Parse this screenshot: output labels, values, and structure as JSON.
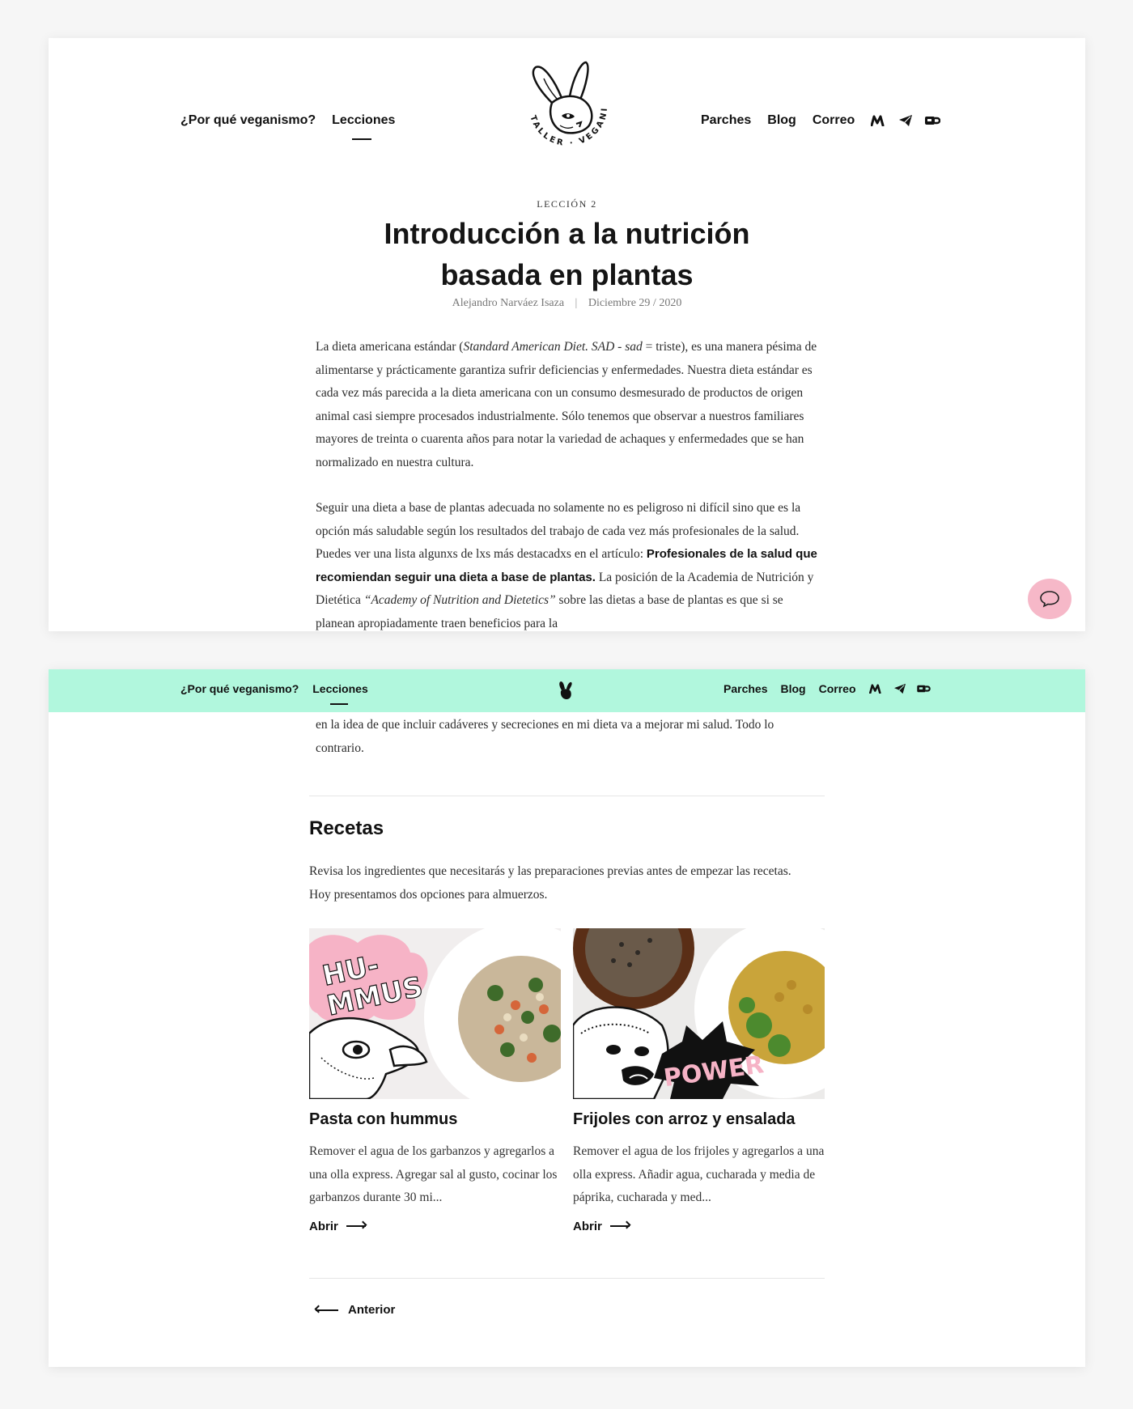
{
  "nav": {
    "why_vegan": "¿Por qué veganismo?",
    "lessons": "Lecciones",
    "patches": "Parches",
    "blog": "Blog",
    "mail": "Correo",
    "icons": [
      "medium-icon",
      "telegram-icon",
      "coffee-cup-icon"
    ],
    "logo_text": "TALLER · VEGANISTA"
  },
  "article": {
    "kicker": "LECCIÓN 2",
    "title_line1": "Introducción a la nutrición",
    "title_line2": "basada en plantas",
    "author": "Alejandro Narváez Isaza",
    "date": "Diciembre 29 / 2020",
    "p1_a": "La dieta americana estándar (",
    "p1_em": "Standard American Diet. SAD - sad",
    "p1_b": " = triste), es una manera pésima de alimentarse y prácticamente garantiza sufrir deficiencias y enfermedades. Nuestra dieta estándar es cada vez más parecida a la dieta americana con un consumo desmesurado de productos de origen animal casi siempre procesados industrialmente. Sólo tenemos que observar a nuestros familiares mayores de treinta o cuarenta años para notar la variedad de achaques y enfermedades que se han normalizado en nuestra cultura.",
    "p2_a": "Seguir una dieta a base de plantas adecuada no solamente no es peligroso ni difícil sino que es la opción más saludable según los resultados del trabajo de cada vez más profesionales de la salud. Puedes ver una lista algunxs de lxs más destacadxs en el artículo: ",
    "p2_bold": "Profesionales de la salud que recomiendan seguir una dieta a base de plantas.",
    "p2_b": " La posición de la Academia de Nutrición y Dietética ",
    "p2_em": "“Academy of Nutrition and Dietetics”",
    "p2_c": " sobre las dietas a base de plantas es que si se planean apropiadamente traen beneficios para la",
    "continued": "en la idea de que incluir cadáveres y secreciones en mi dieta va a mejorar mi salud. Todo lo contrario."
  },
  "recipes": {
    "title": "Recetas",
    "intro": "Revisa los ingredientes que necesitarás y las preparaciones previas antes de empezar las recetas. Hoy presentamos dos opciones para almuerzos.",
    "items": [
      {
        "badge": "HU-MMUS",
        "title": "Pasta con hummus",
        "desc": "Remover el agua de los garbanzos y agregarlos a una olla express. Agregar sal al gusto, cocinar los garbanzos durante 30 mi...",
        "link": "Abrir"
      },
      {
        "badge": "POWER",
        "title": "Frijoles con arroz y ensalada",
        "desc": "Remover el agua de los frijoles y agregarlos a una olla express. Añadir agua, cucharada y media de páprika, cucharada y med...",
        "link": "Abrir"
      }
    ],
    "prev": "Anterior"
  },
  "colors": {
    "sticky_nav_bg": "#b1f7dd",
    "chat_button": "#f6b8c8",
    "accent_pink": "#f6b8c8"
  }
}
